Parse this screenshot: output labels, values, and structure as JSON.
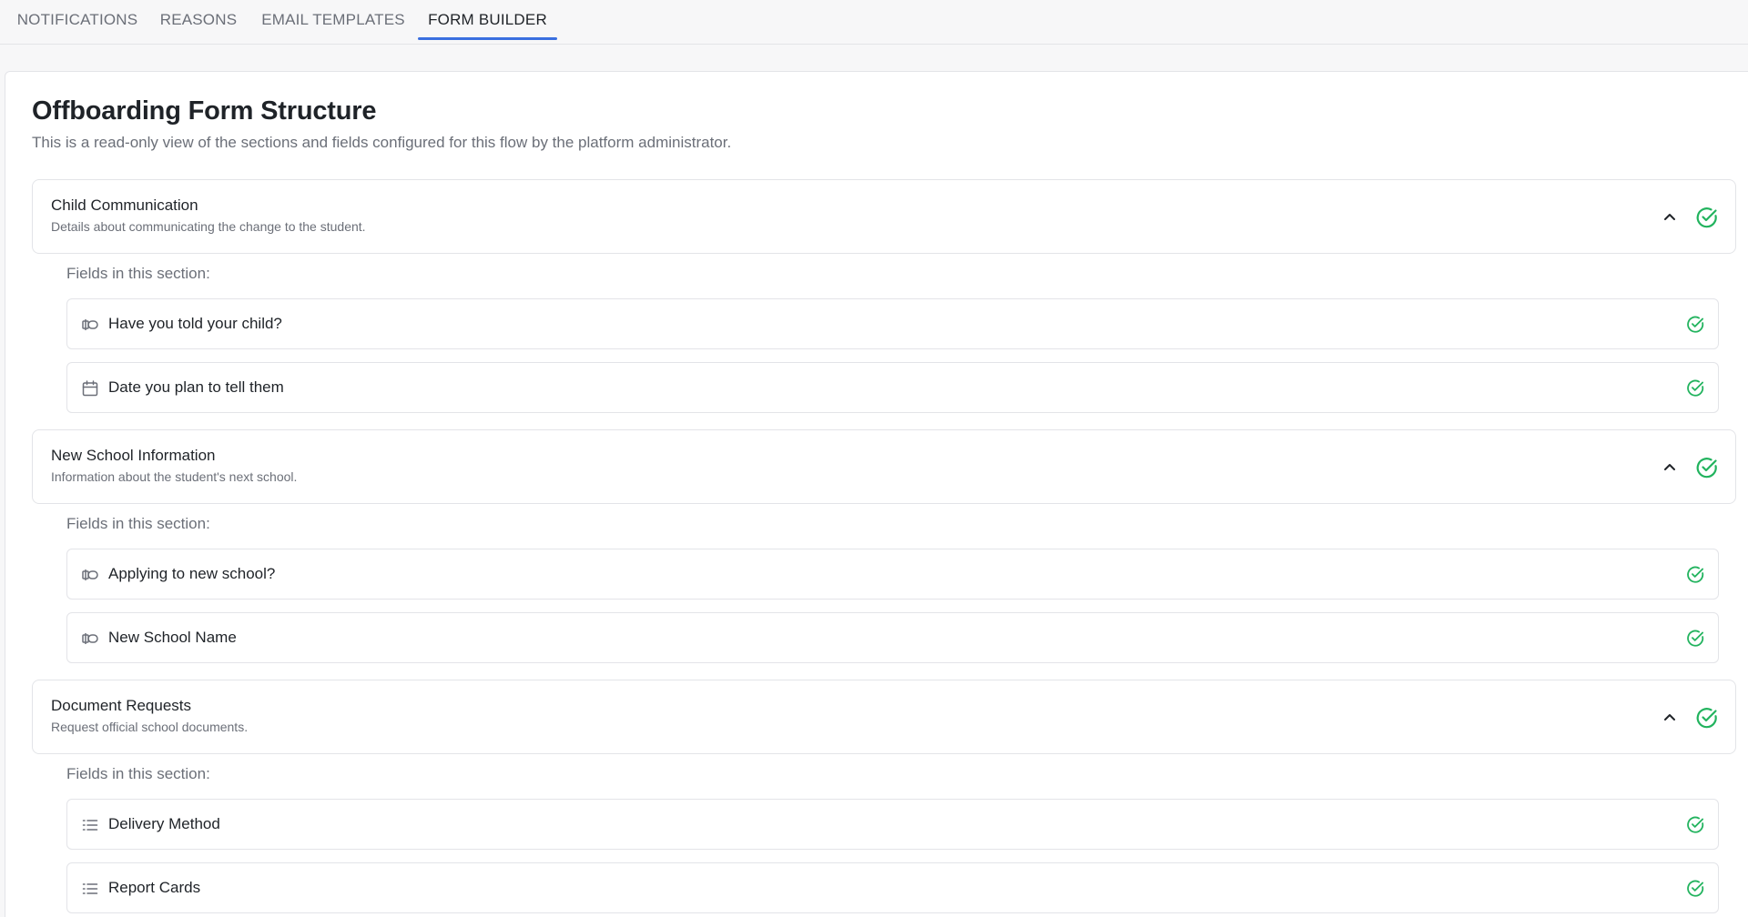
{
  "tabs": [
    {
      "label": "NOTIFICATIONS"
    },
    {
      "label": "REASONS"
    },
    {
      "label": "EMAIL TEMPLATES"
    },
    {
      "label": "FORM BUILDER"
    }
  ],
  "page": {
    "title": "Offboarding Form Structure",
    "description": "This is a read-only view of the sections and fields configured for this flow by the platform administrator."
  },
  "fields_label": "Fields in this section:",
  "colors": {
    "accent": "#3a6fe0",
    "success": "#22b35e"
  },
  "sections": [
    {
      "title": "Child Communication",
      "subtitle": "Details about communicating the change to the student.",
      "fields": [
        {
          "label": "Have you told your child?",
          "icon": "toggle-icon"
        },
        {
          "label": "Date you plan to tell them",
          "icon": "calendar-icon"
        }
      ]
    },
    {
      "title": "New School Information",
      "subtitle": "Information about the student's next school.",
      "fields": [
        {
          "label": "Applying to new school?",
          "icon": "toggle-icon"
        },
        {
          "label": "New School Name",
          "icon": "toggle-icon"
        }
      ]
    },
    {
      "title": "Document Requests",
      "subtitle": "Request official school documents.",
      "fields": [
        {
          "label": "Delivery Method",
          "icon": "list-icon"
        },
        {
          "label": "Report Cards",
          "icon": "list-icon"
        }
      ]
    }
  ]
}
